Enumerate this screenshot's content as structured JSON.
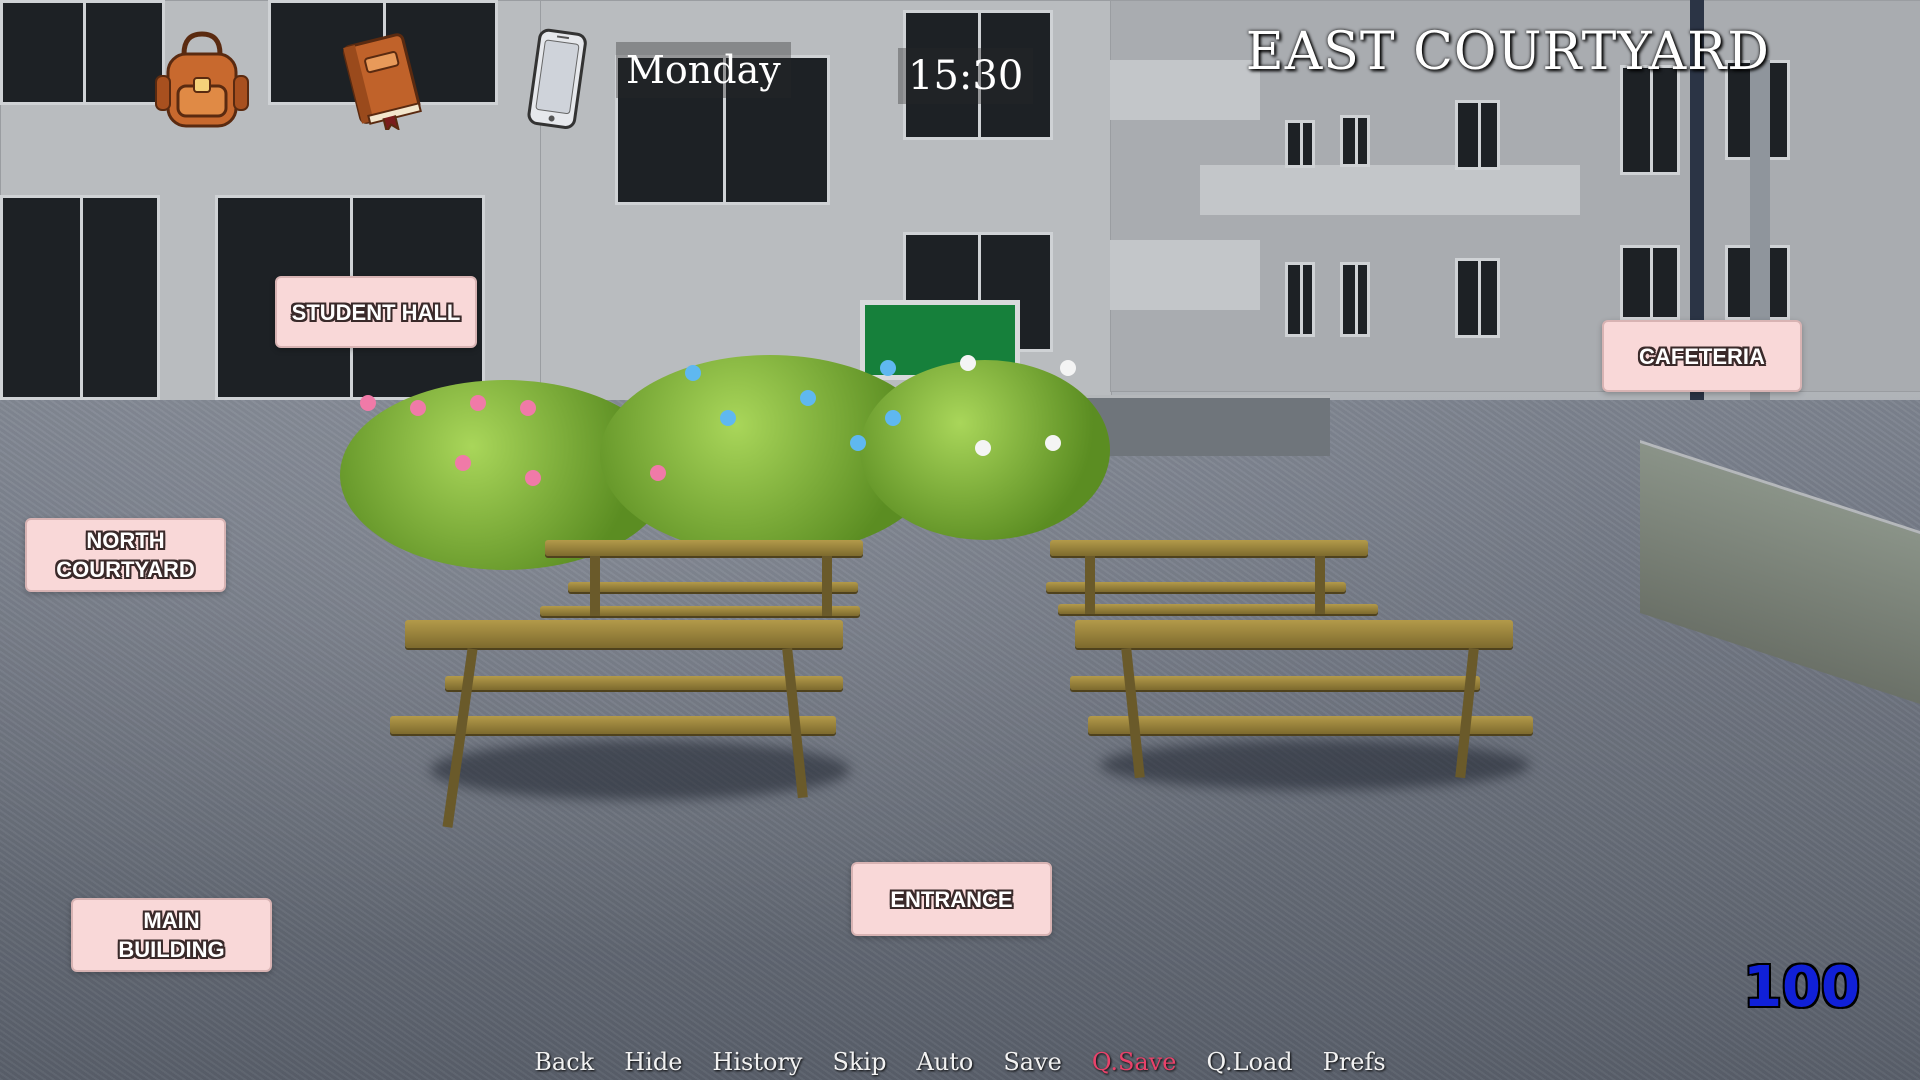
{
  "hud": {
    "day": "Monday",
    "time": "15:30",
    "location": "EAST COURTYARD",
    "counter": "100",
    "icons": {
      "backpack": "backpack-icon",
      "journal": "book-icon",
      "phone": "phone-icon"
    }
  },
  "nav": {
    "student_hall": "STUDENT HALL",
    "cafeteria": "CAFETERIA",
    "north_courtyard": "NORTH\nCOURTYARD",
    "main_building": "MAIN\nBUILDING",
    "entrance": "ENTRANCE"
  },
  "quick_menu": {
    "back": "Back",
    "hide": "Hide",
    "history": "History",
    "skip": "Skip",
    "auto": "Auto",
    "save": "Save",
    "qsave": "Q.Save",
    "qload": "Q.Load",
    "prefs": "Prefs"
  },
  "colors": {
    "nav_bg": "#f9d8d8",
    "counter": "#1020d8",
    "active_menu": "#e8426a"
  }
}
